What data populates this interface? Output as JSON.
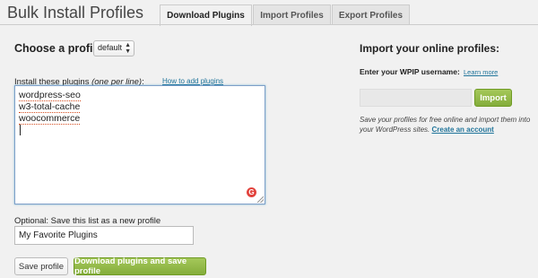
{
  "page": {
    "title": "Bulk Install Profiles"
  },
  "tabs": [
    {
      "label": "Download Plugins",
      "active": true
    },
    {
      "label": "Import Profiles",
      "active": false
    },
    {
      "label": "Export Profiles",
      "active": false
    }
  ],
  "choose": {
    "label": "Choose a profile:",
    "selected": "default"
  },
  "plugins": {
    "label": "Install these plugins",
    "label_note": "(one per line)",
    "help_link": "How to add plugins",
    "lines": [
      "wordpress-seo",
      "w3-total-cache",
      "woocommerce"
    ],
    "spellcheck_icon": "G"
  },
  "save_profile": {
    "label": "Optional: Save this list as a new profile",
    "value": "My Favorite Plugins"
  },
  "buttons": {
    "save": "Save profile",
    "download": "Download plugins and save profile",
    "import": "Import"
  },
  "import_panel": {
    "title": "Import your online profiles:",
    "username_label": "Enter your WPIP username:",
    "learn_more": "Learn more",
    "username_value": "",
    "description": "Save your profiles for free online and import them into your WordPress sites.",
    "create_account": "Create an account"
  },
  "colors": {
    "accent_green": "#84ad3b",
    "link_blue": "#21759b",
    "background": "#f1f1f1"
  }
}
